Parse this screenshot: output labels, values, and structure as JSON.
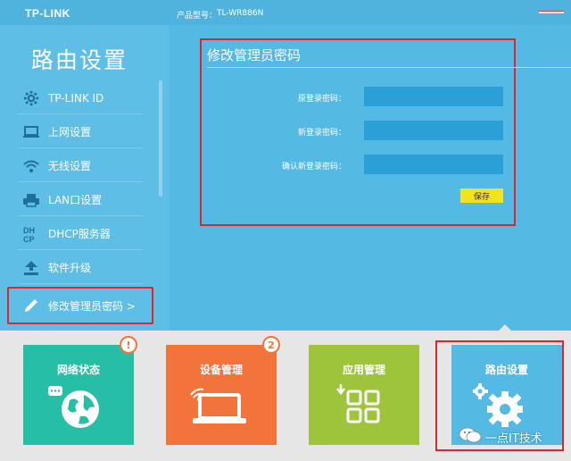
{
  "header": {
    "logo": "TP-LINK",
    "model_label": "产品型号：",
    "model_value": "TL-WR886N"
  },
  "sidebar": {
    "title": "路由设置",
    "items": [
      {
        "label": "TP-LINK ID",
        "icon": "gear-icon"
      },
      {
        "label": "上网设置",
        "icon": "monitor-icon"
      },
      {
        "label": "无线设置",
        "icon": "wifi-icon"
      },
      {
        "label": "LAN口设置",
        "icon": "printer-icon"
      },
      {
        "label": "DHCP服务器",
        "icon": "dhcp-icon"
      },
      {
        "label": "软件升级",
        "icon": "upload-icon"
      },
      {
        "label": "修改管理员密码 >",
        "icon": "pencil-icon"
      }
    ]
  },
  "form": {
    "title": "修改管理员密码",
    "fields": [
      {
        "label": "原登录密码：",
        "value": ""
      },
      {
        "label": "新登录密码：",
        "value": ""
      },
      {
        "label": "确认新登录密码：",
        "value": ""
      }
    ],
    "save_label": "保存"
  },
  "tiles": [
    {
      "label": "网络状态",
      "color": "#26bfa6",
      "icon": "globe-icon",
      "badge": "!"
    },
    {
      "label": "设备管理",
      "color": "#f2743b",
      "icon": "laptop-icon",
      "badge": "2"
    },
    {
      "label": "应用管理",
      "color": "#9dc43a",
      "icon": "apps-icon",
      "badge": ""
    },
    {
      "label": "路由设置",
      "color": "#54b9e3",
      "icon": "settings-gear-icon",
      "badge": ""
    }
  ],
  "watermark": {
    "text": "一点IT技术"
  },
  "colors": {
    "background": "#54b9e3",
    "sidebar": "#5ebee6",
    "input": "#2ba0d6",
    "save_button": "#f2e31c",
    "highlight_border": "#d9272e"
  }
}
